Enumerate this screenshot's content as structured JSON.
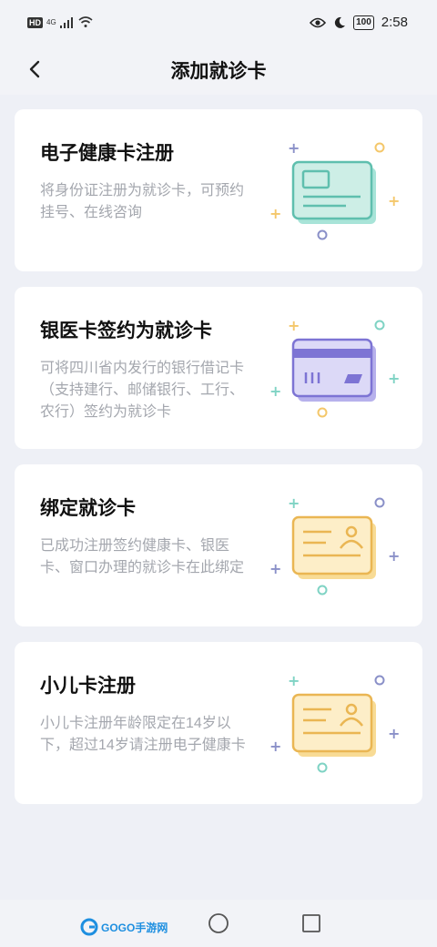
{
  "status_bar": {
    "hd": "HD",
    "network": "4G",
    "battery": "100",
    "time": "2:58"
  },
  "header": {
    "title": "添加就诊卡"
  },
  "cards": [
    {
      "title": "电子健康卡注册",
      "desc": "将身份证注册为就诊卡，可预约挂号、在线咨询",
      "icon": "health-card-icon"
    },
    {
      "title": "银医卡签约为就诊卡",
      "desc": "可将四川省内发行的银行借记卡（支持建行、邮储银行、工行、农行）签约为就诊卡",
      "icon": "bank-card-icon"
    },
    {
      "title": "绑定就诊卡",
      "desc": "已成功注册签约健康卡、银医卡、窗口办理的就诊卡在此绑定",
      "icon": "id-card-icon"
    },
    {
      "title": "小儿卡注册",
      "desc": "小儿卡注册年龄限定在14岁以下，超过14岁请注册电子健康卡",
      "icon": "id-card-icon"
    }
  ],
  "watermark": {
    "text": "GOGO手游网"
  },
  "colors": {
    "teal": "#7fd3c4",
    "purple": "#8e86d8",
    "yellow": "#f4c76a"
  }
}
